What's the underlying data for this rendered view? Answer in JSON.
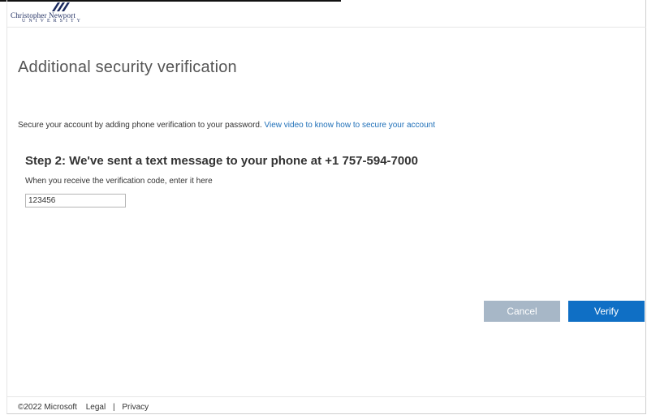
{
  "brand": {
    "line1": "Christopher Newport",
    "line2": "UNIVERSITY"
  },
  "page": {
    "title": "Additional security verification",
    "intro_text": "Secure your account by adding phone verification to your password.",
    "intro_link": "View video to know how to secure your account",
    "step_heading": "Step 2: We've sent a text message to your phone at +1 757-594-7000",
    "instruction": "When you receive the verification code, enter it here"
  },
  "form": {
    "code_value": "123456"
  },
  "actions": {
    "cancel_label": "Cancel",
    "verify_label": "Verify"
  },
  "footer": {
    "copyright": "©2022 Microsoft",
    "legal": "Legal",
    "separator": "|",
    "privacy": "Privacy"
  },
  "colors": {
    "accent": "#0f6fc5",
    "disabled_button": "#a7b7c7",
    "link": "#1e6fb8"
  }
}
